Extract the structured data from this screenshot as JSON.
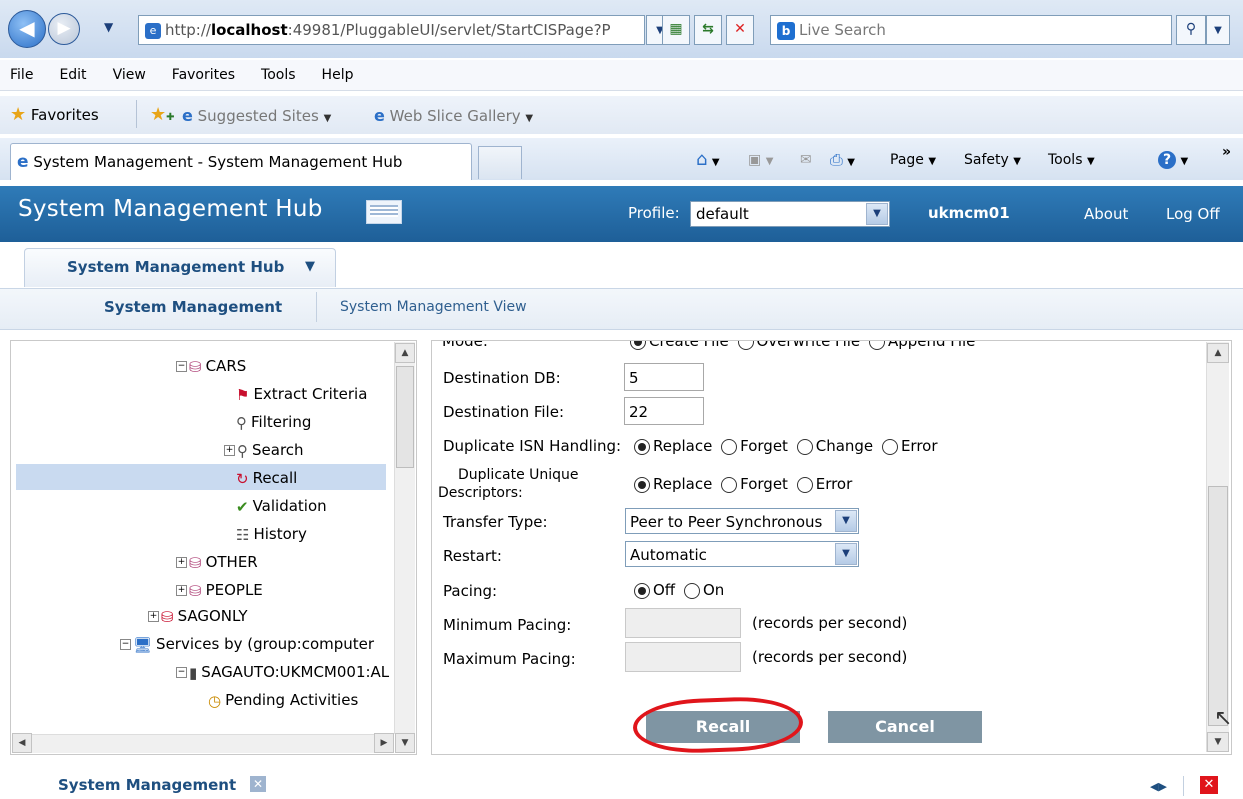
{
  "browser": {
    "url_prefix": "http://",
    "url_host": "localhost",
    "url_rest": ":49981/PluggableUI/servlet/StartCISPage?P",
    "search_placeholder": "Live Search",
    "menu": [
      "File",
      "Edit",
      "View",
      "Favorites",
      "Tools",
      "Help"
    ],
    "favorites_label": "Favorites",
    "fav_links": [
      "Suggested Sites",
      "Web Slice Gallery"
    ],
    "tab_title": "System Management - System Management Hub",
    "commands": [
      "Page",
      "Safety",
      "Tools"
    ],
    "chevron": "»"
  },
  "app": {
    "title": "System Management Hub",
    "profile_label": "Profile:",
    "profile_value": "default",
    "user": "ukmcm01",
    "about": "About",
    "logoff": "Log Off",
    "hub_tab": "System Management Hub",
    "subnav": [
      "System Management",
      "System Management View"
    ]
  },
  "tree": {
    "items": [
      {
        "label": "CARS",
        "toggle": "−"
      },
      {
        "label": "Extract Criteria"
      },
      {
        "label": "Filtering"
      },
      {
        "label": "Search",
        "toggle": "+"
      },
      {
        "label": "Recall",
        "selected": true
      },
      {
        "label": "Validation"
      },
      {
        "label": "History"
      },
      {
        "label": "OTHER",
        "toggle": "+"
      },
      {
        "label": "PEOPLE",
        "toggle": "+"
      },
      {
        "label": "SAGONLY",
        "toggle": "+"
      },
      {
        "label": "Services by (group:computer",
        "toggle": "−"
      },
      {
        "label": "SAGAUTO:UKMCM001:AL",
        "toggle": "−"
      },
      {
        "label": "Pending Activities"
      }
    ]
  },
  "form": {
    "mode_label": "Mode:",
    "mode_options": [
      "Create File",
      "Overwrite File",
      "Append File"
    ],
    "dest_db_label": "Destination DB:",
    "dest_db_value": "5",
    "dest_file_label": "Destination File:",
    "dest_file_value": "22",
    "dup_isn_label": "Duplicate ISN Handling:",
    "dup_isn_options": [
      "Replace",
      "Forget",
      "Change",
      "Error"
    ],
    "dup_unique_label_1": "Duplicate Unique",
    "dup_unique_label_2": "Descriptors:",
    "dup_unique_options": [
      "Replace",
      "Forget",
      "Error"
    ],
    "transfer_type_label": "Transfer Type:",
    "transfer_type_value": "Peer to Peer Synchronous",
    "restart_label": "Restart:",
    "restart_value": "Automatic",
    "pacing_label": "Pacing:",
    "pacing_options": [
      "Off",
      "On"
    ],
    "min_pacing_label": "Minimum Pacing:",
    "max_pacing_label": "Maximum Pacing:",
    "rps_unit": "(records per second)",
    "recall_button": "Recall",
    "cancel_button": "Cancel"
  },
  "status": {
    "title": "System Management"
  },
  "colors": {
    "header": "#1e5f98",
    "highlight": "#e0151b",
    "button": "#7f95a3",
    "selected_row": "#c9daf0"
  }
}
